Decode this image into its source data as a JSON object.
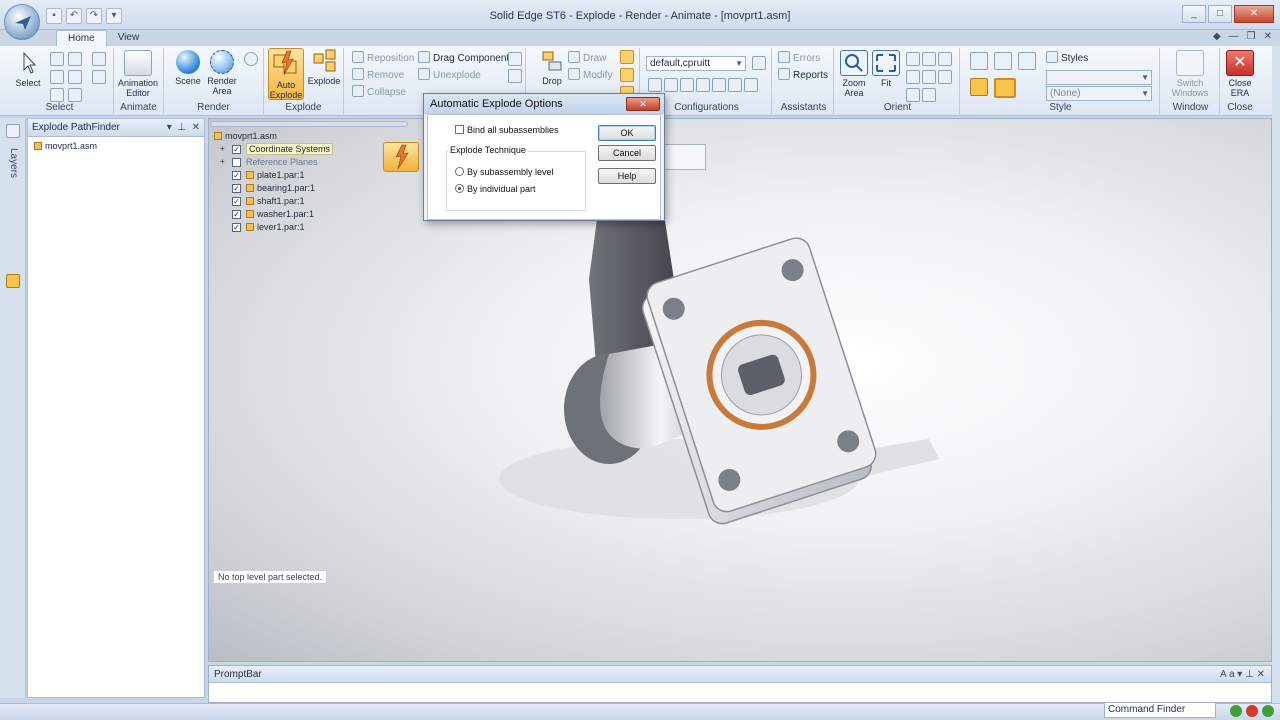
{
  "window": {
    "title": "Solid Edge ST6 - Explode - Render - Animate - [movprt1.asm]",
    "controls": [
      "_",
      "□",
      "✕"
    ]
  },
  "tabs": [
    "Home",
    "View"
  ],
  "ribbon": {
    "select": {
      "label": "Select",
      "group": "Select"
    },
    "animate": {
      "label": "Animation Editor",
      "group": "Animate"
    },
    "render": {
      "scene": "Scene",
      "render_area": "Render Area",
      "group": "Render"
    },
    "explode": {
      "auto_explode": "Auto Explode",
      "explode": "Explode",
      "reposition": "Reposition",
      "remove": "Remove",
      "collapse": "Collapse",
      "drag_component": "Drag Component",
      "unexplode": "Unexplode",
      "draw": "Draw",
      "modify": "Modify",
      "drop": "Drop",
      "group": "Explode"
    },
    "configurations": {
      "value": "default,cpruitt",
      "group": "Configurations"
    },
    "assistants": {
      "errors": "Errors",
      "reports": "Reports",
      "group": "Assistants"
    },
    "orient": {
      "zoom_area": "Zoom Area",
      "fit": "Fit",
      "group": "Orient"
    },
    "style": {
      "styles": "Styles",
      "none": "(None)",
      "group": "Style"
    },
    "window": {
      "switch_windows": "Switch Windows",
      "group": "Window"
    },
    "close": {
      "close_era": "Close ERA",
      "group": "Close"
    }
  },
  "pathfinder": {
    "title": "Explode PathFinder",
    "item": "movprt1.asm",
    "layers_tab": "Layers"
  },
  "tree": {
    "root": "movprt1.asm",
    "items": [
      {
        "label": "Coordinate Systems",
        "checked": true
      },
      {
        "label": "Reference Planes",
        "checked": false
      },
      {
        "label": "plate1.par:1",
        "checked": true
      },
      {
        "label": "bearing1.par:1",
        "checked": true
      },
      {
        "label": "shaft1.par:1",
        "checked": true
      },
      {
        "label": "washer1.par:1",
        "checked": true
      },
      {
        "label": "lever1.par:1",
        "checked": true
      }
    ]
  },
  "status_text": "No top level part selected.",
  "dialog": {
    "title": "Automatic Explode Options",
    "bind_label": "Bind all subassemblies",
    "technique_label": "Explode Technique",
    "radio_subassembly": "By subassembly level",
    "radio_individual": "By individual part",
    "ok": "OK",
    "cancel": "Cancel",
    "help": "Help"
  },
  "promptbar": {
    "title": "PromptBar"
  },
  "statusbar": {
    "command_finder": "Command Finder"
  },
  "colors": {
    "accent": "#f4b63a",
    "ribbon": "#dde7f3",
    "bearing": "#c97a3a"
  }
}
